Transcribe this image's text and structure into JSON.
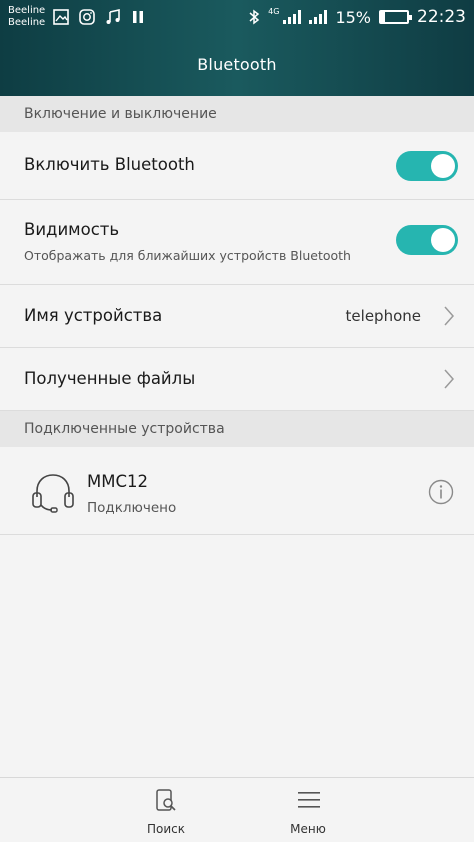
{
  "status_bar": {
    "carrier_1": "Beeline",
    "carrier_2": "Beeline",
    "network_type": "4G",
    "battery_percent": "15%",
    "battery_level": 0.15,
    "time": "22:23",
    "icons": [
      "image-icon",
      "instagram-icon",
      "music-icon",
      "pause-icon",
      "bluetooth-icon",
      "signal-icon",
      "signal-icon",
      "battery-icon"
    ]
  },
  "header": {
    "title": "Bluetooth"
  },
  "sections": {
    "power_header": "Включение и выключение",
    "connected_header": "Подключенные устройства"
  },
  "settings": {
    "enable_bluetooth": {
      "label": "Включить Bluetooth",
      "on": true
    },
    "visibility": {
      "label": "Видимость",
      "subtitle": "Отображать для ближайших устройств Bluetooth",
      "on": true
    },
    "device_name": {
      "label": "Имя устройства",
      "value": "telephone"
    },
    "received_files": {
      "label": "Полученные файлы"
    }
  },
  "connected_devices": [
    {
      "name": "MMC12",
      "status": "Подключено",
      "icon": "headset-icon"
    }
  ],
  "bottom_bar": {
    "search_label": "Поиск",
    "menu_label": "Меню"
  },
  "colors": {
    "accent": "#26b5b0",
    "header": "#1a5a5e"
  }
}
